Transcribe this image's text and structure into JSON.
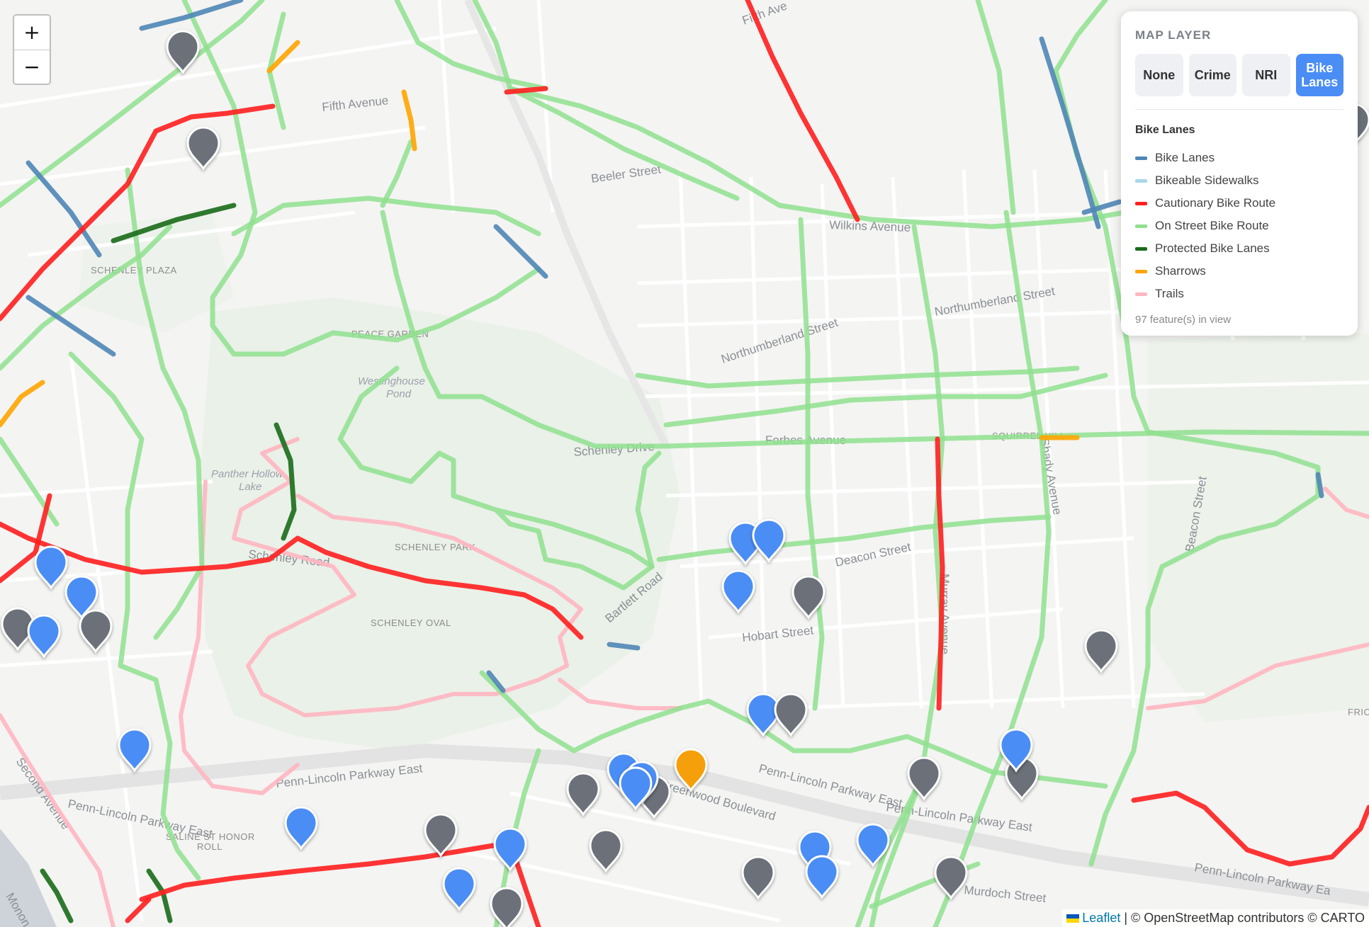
{
  "zoom": {
    "in_label": "+",
    "out_label": "−"
  },
  "panel": {
    "title": "MAP LAYER",
    "buttons": [
      {
        "label": "None",
        "active": false
      },
      {
        "label": "Crime",
        "active": false
      },
      {
        "label": "NRI",
        "active": false
      },
      {
        "label": "Bike Lanes",
        "active": true
      }
    ],
    "legend_title": "Bike Lanes",
    "legend": [
      {
        "label": "Bike Lanes",
        "color": "#4f86b6"
      },
      {
        "label": "Bikeable Sidewalks",
        "color": "#a9d8ea"
      },
      {
        "label": "Cautionary Bike Route",
        "color": "#ff1f1f"
      },
      {
        "label": "On Street Bike Route",
        "color": "#8fe08f"
      },
      {
        "label": "Protected Bike Lanes",
        "color": "#1a6b1a"
      },
      {
        "label": "Sharrows",
        "color": "#ffa500"
      },
      {
        "label": "Trails",
        "color": "#ffb6c1"
      }
    ],
    "feature_count": "97 feature(s) in view"
  },
  "attribution": {
    "leaflet": "Leaflet",
    "rest": " | © OpenStreetMap contributors © CARTO"
  },
  "labels": {
    "fifth_ave": "Fifth Avenue",
    "fifth_ave2": "Fifth Ave",
    "beeler": "Beeler Street",
    "wilkins": "Wilkins Avenue",
    "wilkins2": "Avenue",
    "northumberland": "Northumberland Street",
    "northumberland2": "Northumberland Street",
    "schenley_plaza": "SCHENLEY PLAZA",
    "peace_garden": "PEACE GARDEN",
    "westinghouse": "Westinghouse",
    "pond": "Pond",
    "panther": "Panther Hollow",
    "lake": "Lake",
    "schenley_park": "SCHENLEY PARK",
    "schenley_oval": "SCHENLEY OVAL",
    "schenley_road": "Schenley Road",
    "schenley_drive": "Schenley Drive",
    "squirrel_hill": "SQUIRREL HILL",
    "forbes": "Forbes Avenue",
    "deacon": "Deacon Street",
    "hobart": "Hobart Street",
    "bartlett": "Bartlett Road",
    "penn_lincoln": "Penn-Lincoln Parkway East",
    "penn_lincoln2": "Penn-Lincoln Parkway East",
    "penn_lincoln3": "Penn-Lincoln Parkway East",
    "penn_lincoln4": "Penn-Lincoln Parkway Ea",
    "penn_lincoln5": "Penn-Lincoln Parkway East",
    "greenfield": "Greenwood Boulevard",
    "second_ave": "Second Avenue",
    "saline": "SALINE ST HONOR",
    "roll": "ROLL",
    "murray": "Murray Avenue",
    "shady": "Shady Avenue",
    "mon": "Monon",
    "frick": "FRIC",
    "avenue": "Avenue",
    "murdoch": "Murdoch Street",
    "beacon": "Beacon Street"
  }
}
